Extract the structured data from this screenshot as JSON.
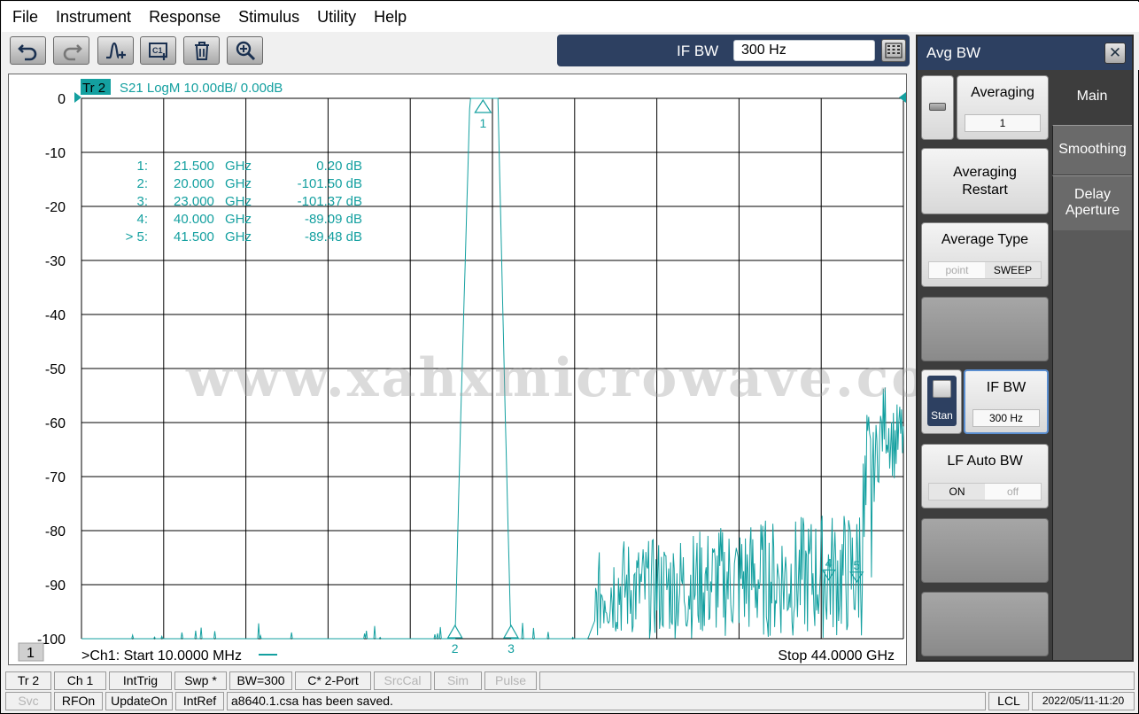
{
  "menu": [
    "File",
    "Instrument",
    "Response",
    "Stimulus",
    "Utility",
    "Help"
  ],
  "toolbar": {
    "icons": [
      "undo-icon",
      "redo-icon",
      "add-marker-icon",
      "add-channel-icon",
      "trash-icon",
      "zoom-icon"
    ],
    "ifbw_label": "IF BW",
    "ifbw_value": "300 Hz"
  },
  "plot": {
    "trace_tag": "Tr 2",
    "trace_info": "S21 LogM 10.00dB/  0.00dB",
    "y_ticks": [
      "0",
      "-10",
      "-20",
      "-30",
      "-40",
      "-50",
      "-60",
      "-70",
      "-80",
      "-90",
      "-100"
    ],
    "markers": [
      {
        "prefix": "1:",
        "freq": "21.500",
        "unit": "GHz",
        "value": "0.20 dB"
      },
      {
        "prefix": "2:",
        "freq": "20.000",
        "unit": "GHz",
        "value": "-101.50 dB"
      },
      {
        "prefix": "3:",
        "freq": "23.000",
        "unit": "GHz",
        "value": "-101.37 dB"
      },
      {
        "prefix": "4:",
        "freq": "40.000",
        "unit": "GHz",
        "value": "-89.09 dB"
      },
      {
        "prefix": "> 5:",
        "freq": "41.500",
        "unit": "GHz",
        "value": "-89.48 dB"
      }
    ],
    "marker_labels": [
      "1",
      "2",
      "3",
      "4",
      "5"
    ],
    "channel_badge": "1",
    "start_label": ">Ch1:  Start   10.0000 MHz",
    "stop_label": "Stop  44.0000 GHz",
    "watermark": "www.xahxmicrowave.com",
    "trace_color": "#14a0a0"
  },
  "chart_data": {
    "type": "line",
    "title": "",
    "xlabel": "",
    "ylabel": "",
    "xlim": [
      0.01,
      44.0
    ],
    "ylim": [
      -100,
      0
    ],
    "series": [
      {
        "values_x": [
          0.01,
          3.0,
          6.0,
          9.0,
          12.0,
          15.0,
          18.0,
          19.5,
          20.0,
          20.3,
          20.8,
          21.0,
          21.5,
          22.0,
          22.3,
          22.7,
          23.0,
          23.5,
          25.0,
          27.0,
          28.0,
          30.0,
          32.0,
          34.0,
          36.0,
          38.0,
          40.0,
          41.5,
          42.0,
          42.5,
          43.0,
          43.5,
          44.0
        ],
        "values_y": [
          -101,
          -101,
          -101,
          -101,
          -101,
          -101,
          -101,
          -101,
          -101,
          -60,
          0,
          0,
          0.2,
          0,
          0,
          -60,
          -101,
          -101,
          -101,
          -101,
          -92,
          -93,
          -92,
          -91,
          -90,
          -90,
          -89,
          -89,
          -75,
          -68,
          -60,
          -65,
          -63
        ]
      }
    ]
  },
  "panel": {
    "title": "Avg BW",
    "close": "✕",
    "tabs": [
      "Main",
      "Smoothing",
      "Delay Aperture"
    ],
    "averaging_label": "Averaging",
    "averaging_value": "1",
    "averaging_restart": "Averaging Restart",
    "average_type_label": "Average Type",
    "average_type_options": [
      "point",
      "SWEEP"
    ],
    "stan_label": "Stan",
    "ifbw_label": "IF BW",
    "ifbw_value": "300 Hz",
    "lf_auto_label": "LF Auto BW",
    "lf_auto_options": [
      "ON",
      "off"
    ]
  },
  "status_row1": [
    "Tr 2",
    "Ch 1",
    "IntTrig",
    "Swp *",
    "BW=300",
    "C* 2-Port",
    "SrcCal",
    "Sim",
    "Pulse"
  ],
  "status_row2": [
    "Svc",
    "RFOn",
    "UpdateOn",
    "IntRef",
    "a8640.1.csa has been saved.",
    "LCL",
    "2022/05/11-11:20"
  ]
}
